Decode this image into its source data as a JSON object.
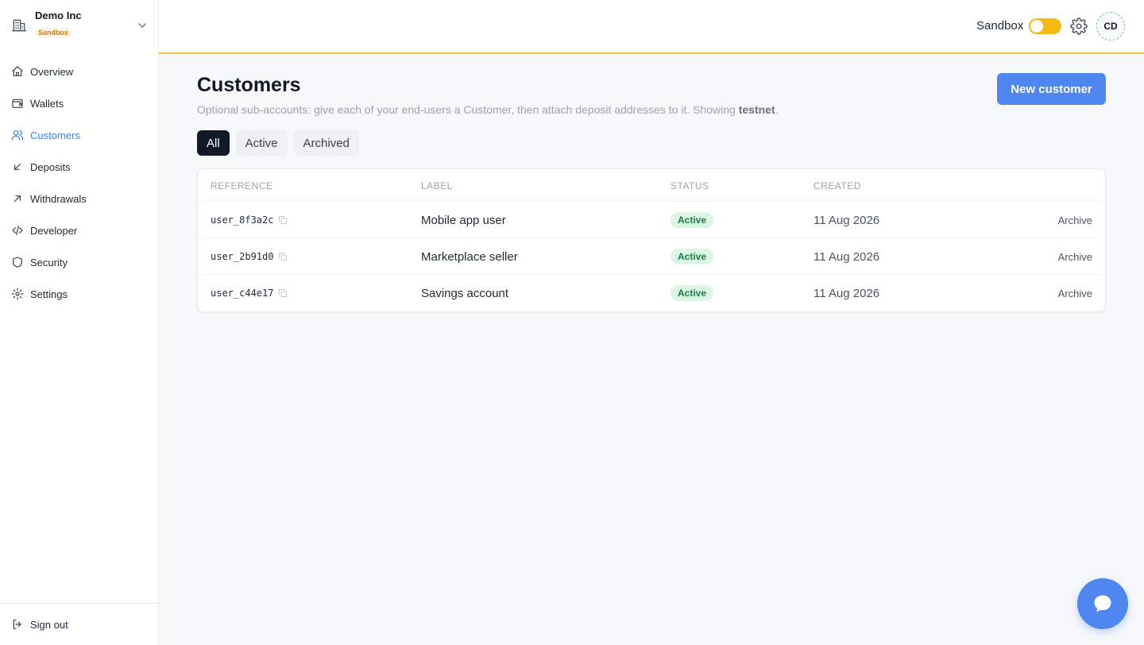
{
  "org": {
    "name": "Demo Inc",
    "badge": "Sandbox"
  },
  "nav": [
    {
      "label": "Overview",
      "icon": "home-icon"
    },
    {
      "label": "Wallets",
      "icon": "wallet-icon"
    },
    {
      "label": "Customers",
      "icon": "users-icon",
      "active": true
    },
    {
      "label": "Deposits",
      "icon": "arrow-down-left-icon"
    },
    {
      "label": "Withdrawals",
      "icon": "arrow-up-right-icon"
    },
    {
      "label": "Developer",
      "icon": "code-icon"
    },
    {
      "label": "Security",
      "icon": "shield-icon"
    },
    {
      "label": "Settings",
      "icon": "gear-icon"
    }
  ],
  "sign_out": "Sign out",
  "header": {
    "sandbox_label": "Sandbox",
    "avatar_initials": "CD"
  },
  "page": {
    "title": "Customers",
    "subtitle_prefix": "Optional sub-accounts: give each of your end-users a Customer, then attach deposit addresses to it. Showing ",
    "subtitle_network": "testnet",
    "subtitle_suffix": ".",
    "new_button": "New customer"
  },
  "tabs": [
    {
      "label": "All",
      "active": true
    },
    {
      "label": "Active"
    },
    {
      "label": "Archived"
    }
  ],
  "table": {
    "headers": {
      "reference": "REFERENCE",
      "label": "LABEL",
      "status": "STATUS",
      "created": "CREATED"
    },
    "rows": [
      {
        "reference": "user_8f3a2c",
        "label": "Mobile app user",
        "status": "Active",
        "created": "11 Aug 2026",
        "action": "Archive"
      },
      {
        "reference": "user_2b91d0",
        "label": "Marketplace seller",
        "status": "Active",
        "created": "11 Aug 2026",
        "action": "Archive"
      },
      {
        "reference": "user_c44e17",
        "label": "Savings account",
        "status": "Active",
        "created": "11 Aug 2026",
        "action": "Archive"
      }
    ]
  },
  "colors": {
    "accent": "#4f86f0",
    "sandbox": "#f5b915",
    "active_badge": "#15803d"
  }
}
